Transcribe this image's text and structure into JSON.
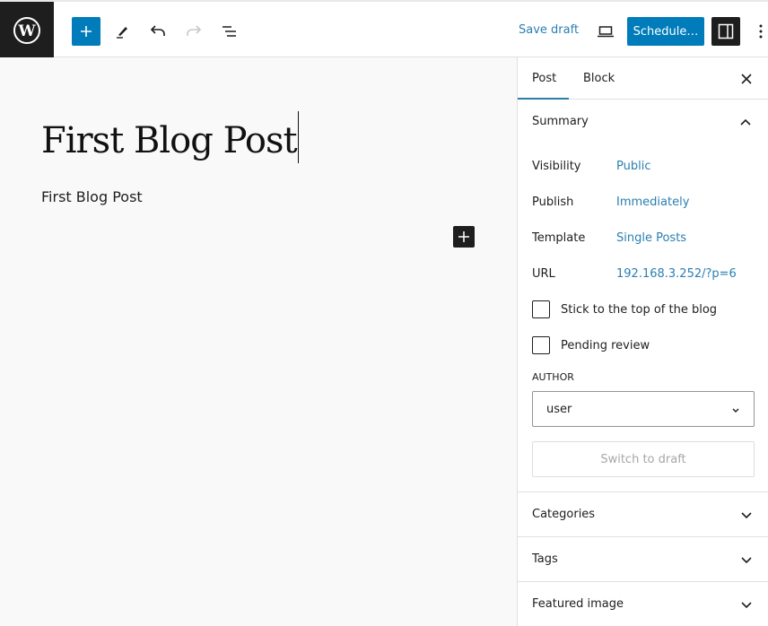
{
  "toolbar": {
    "logo": "wordpress-logo",
    "save_draft_label": "Save draft",
    "schedule_label": "Schedule…",
    "colors": {
      "accent": "#007cba",
      "dark": "#1e1e1e",
      "link": "#2a7fb0"
    }
  },
  "editor": {
    "title": "First Blog Post",
    "paragraph": "First Blog Post"
  },
  "sidebar": {
    "tabs": [
      {
        "label": "Post",
        "active": true
      },
      {
        "label": "Block",
        "active": false
      }
    ],
    "summary": {
      "title": "Summary",
      "rows": [
        {
          "label": "Visibility",
          "value": "Public"
        },
        {
          "label": "Publish",
          "value": "Immediately"
        },
        {
          "label": "Template",
          "value": "Single Posts"
        },
        {
          "label": "URL",
          "value": "192.168.3.252/?p=6"
        }
      ],
      "checkboxes": [
        {
          "label": "Stick to the top of the blog",
          "checked": false
        },
        {
          "label": "Pending review",
          "checked": false
        }
      ],
      "author_label": "AUTHOR",
      "author_value": "user",
      "switch_label": "Switch to draft"
    },
    "panels": [
      {
        "title": "Categories"
      },
      {
        "title": "Tags"
      },
      {
        "title": "Featured image"
      }
    ]
  }
}
